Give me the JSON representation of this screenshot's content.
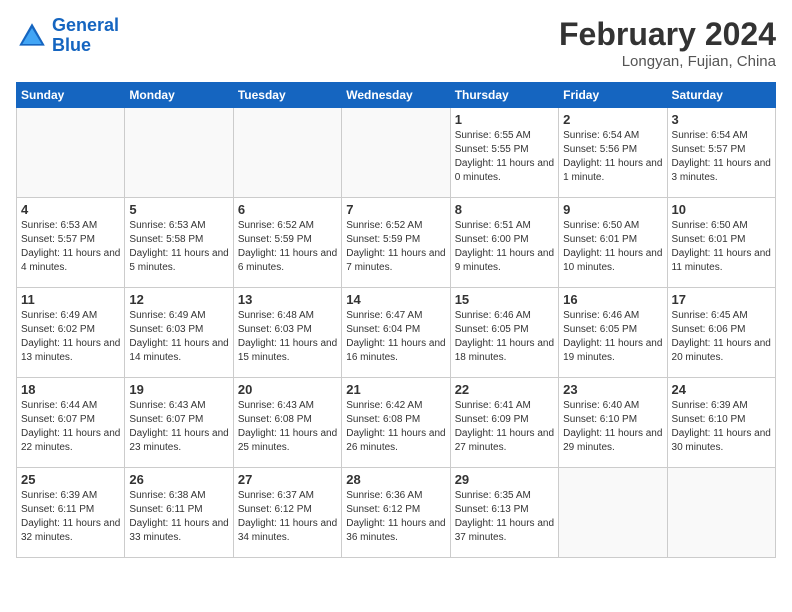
{
  "header": {
    "logo_line1": "General",
    "logo_line2": "Blue",
    "month_year": "February 2024",
    "location": "Longyan, Fujian, China"
  },
  "weekdays": [
    "Sunday",
    "Monday",
    "Tuesday",
    "Wednesday",
    "Thursday",
    "Friday",
    "Saturday"
  ],
  "weeks": [
    [
      {
        "day": "",
        "info": ""
      },
      {
        "day": "",
        "info": ""
      },
      {
        "day": "",
        "info": ""
      },
      {
        "day": "",
        "info": ""
      },
      {
        "day": "1",
        "info": "Sunrise: 6:55 AM\nSunset: 5:55 PM\nDaylight: 11 hours and 0 minutes."
      },
      {
        "day": "2",
        "info": "Sunrise: 6:54 AM\nSunset: 5:56 PM\nDaylight: 11 hours and 1 minute."
      },
      {
        "day": "3",
        "info": "Sunrise: 6:54 AM\nSunset: 5:57 PM\nDaylight: 11 hours and 3 minutes."
      }
    ],
    [
      {
        "day": "4",
        "info": "Sunrise: 6:53 AM\nSunset: 5:57 PM\nDaylight: 11 hours and 4 minutes."
      },
      {
        "day": "5",
        "info": "Sunrise: 6:53 AM\nSunset: 5:58 PM\nDaylight: 11 hours and 5 minutes."
      },
      {
        "day": "6",
        "info": "Sunrise: 6:52 AM\nSunset: 5:59 PM\nDaylight: 11 hours and 6 minutes."
      },
      {
        "day": "7",
        "info": "Sunrise: 6:52 AM\nSunset: 5:59 PM\nDaylight: 11 hours and 7 minutes."
      },
      {
        "day": "8",
        "info": "Sunrise: 6:51 AM\nSunset: 6:00 PM\nDaylight: 11 hours and 9 minutes."
      },
      {
        "day": "9",
        "info": "Sunrise: 6:50 AM\nSunset: 6:01 PM\nDaylight: 11 hours and 10 minutes."
      },
      {
        "day": "10",
        "info": "Sunrise: 6:50 AM\nSunset: 6:01 PM\nDaylight: 11 hours and 11 minutes."
      }
    ],
    [
      {
        "day": "11",
        "info": "Sunrise: 6:49 AM\nSunset: 6:02 PM\nDaylight: 11 hours and 13 minutes."
      },
      {
        "day": "12",
        "info": "Sunrise: 6:49 AM\nSunset: 6:03 PM\nDaylight: 11 hours and 14 minutes."
      },
      {
        "day": "13",
        "info": "Sunrise: 6:48 AM\nSunset: 6:03 PM\nDaylight: 11 hours and 15 minutes."
      },
      {
        "day": "14",
        "info": "Sunrise: 6:47 AM\nSunset: 6:04 PM\nDaylight: 11 hours and 16 minutes."
      },
      {
        "day": "15",
        "info": "Sunrise: 6:46 AM\nSunset: 6:05 PM\nDaylight: 11 hours and 18 minutes."
      },
      {
        "day": "16",
        "info": "Sunrise: 6:46 AM\nSunset: 6:05 PM\nDaylight: 11 hours and 19 minutes."
      },
      {
        "day": "17",
        "info": "Sunrise: 6:45 AM\nSunset: 6:06 PM\nDaylight: 11 hours and 20 minutes."
      }
    ],
    [
      {
        "day": "18",
        "info": "Sunrise: 6:44 AM\nSunset: 6:07 PM\nDaylight: 11 hours and 22 minutes."
      },
      {
        "day": "19",
        "info": "Sunrise: 6:43 AM\nSunset: 6:07 PM\nDaylight: 11 hours and 23 minutes."
      },
      {
        "day": "20",
        "info": "Sunrise: 6:43 AM\nSunset: 6:08 PM\nDaylight: 11 hours and 25 minutes."
      },
      {
        "day": "21",
        "info": "Sunrise: 6:42 AM\nSunset: 6:08 PM\nDaylight: 11 hours and 26 minutes."
      },
      {
        "day": "22",
        "info": "Sunrise: 6:41 AM\nSunset: 6:09 PM\nDaylight: 11 hours and 27 minutes."
      },
      {
        "day": "23",
        "info": "Sunrise: 6:40 AM\nSunset: 6:10 PM\nDaylight: 11 hours and 29 minutes."
      },
      {
        "day": "24",
        "info": "Sunrise: 6:39 AM\nSunset: 6:10 PM\nDaylight: 11 hours and 30 minutes."
      }
    ],
    [
      {
        "day": "25",
        "info": "Sunrise: 6:39 AM\nSunset: 6:11 PM\nDaylight: 11 hours and 32 minutes."
      },
      {
        "day": "26",
        "info": "Sunrise: 6:38 AM\nSunset: 6:11 PM\nDaylight: 11 hours and 33 minutes."
      },
      {
        "day": "27",
        "info": "Sunrise: 6:37 AM\nSunset: 6:12 PM\nDaylight: 11 hours and 34 minutes."
      },
      {
        "day": "28",
        "info": "Sunrise: 6:36 AM\nSunset: 6:12 PM\nDaylight: 11 hours and 36 minutes."
      },
      {
        "day": "29",
        "info": "Sunrise: 6:35 AM\nSunset: 6:13 PM\nDaylight: 11 hours and 37 minutes."
      },
      {
        "day": "",
        "info": ""
      },
      {
        "day": "",
        "info": ""
      }
    ]
  ]
}
